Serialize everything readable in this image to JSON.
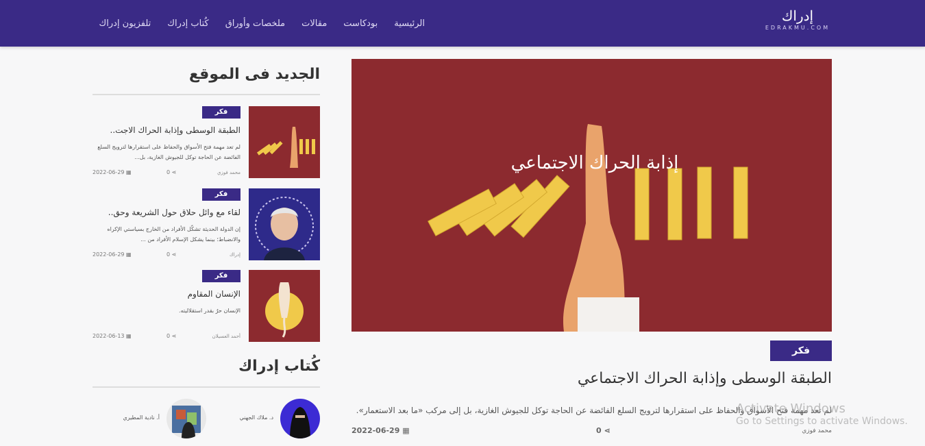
{
  "header": {
    "logo_text": "إدراك",
    "logo_sub": "EDRAKMU.COM",
    "nav": [
      "الرئيسية",
      "بودكاست",
      "مقالات",
      "ملخصات وأوراق",
      "كُتاب إدراك",
      "تلفزيون إدراك"
    ]
  },
  "featured": {
    "category": "فكر",
    "title": "الطبقة الوسطى وإذابة الحراك الاجتماعي",
    "excerpt": "لم تعد مهمة فتح الأسواق والحفاظ على استقرارها لترويج السلع الفائضة عن الحاجة توكل للجيوش الغازية، بل إلى مركب «ما بعد الاستعمار».",
    "date": "2022-06-29",
    "shares": "0",
    "author": "محمد فوزي",
    "overlay_text": "إذابة الحراك الاجتماعي"
  },
  "latest": {
    "heading": "الجديد فى الموقع",
    "posts": [
      {
        "category": "فكر",
        "title": "الطبقة الوسطى وإذابة الحراك الاجت..",
        "excerpt": "لم تعد مهمة فتح الأسواق والحفاظ على استقرارها لترويج السلع الفائضة عن الحاجة توكل للجيوش الغازية، بل...",
        "date": "2022-06-29",
        "shares": "0",
        "author": "محمد فوزي"
      },
      {
        "category": "فكر",
        "title": "لقاء مع وائل حلاق حول الشريعة وحق..",
        "excerpt": "إن الدولة الحديثة تشكّل الأفراد من الخارج بسياستي الإكراه والانضباط؛ بينما يشكل الإسلام الأفراد من ...",
        "date": "2022-06-29",
        "shares": "0",
        "author": "إدراك"
      },
      {
        "category": "فكر",
        "title": "الإنسان المقاوم",
        "excerpt": "الإنسان حرٌ بقدر استقلاليته.",
        "date": "2022-06-13",
        "shares": "0",
        "author": "أحمد العسيلان"
      }
    ]
  },
  "writers": {
    "heading": "كُتاب إدراك",
    "items": [
      {
        "name": "د. ملاك الجهني"
      },
      {
        "name": "أ. نادية المطيري"
      }
    ]
  },
  "watermark": {
    "line1": "Activate Windows",
    "line2": "Go to Settings to activate Windows."
  },
  "colors": {
    "brand": "#3a2a86",
    "hero_bg": "#8c2a2f",
    "domino": "#f0c94a"
  }
}
